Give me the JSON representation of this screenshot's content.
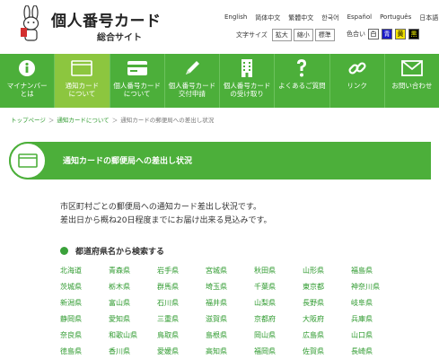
{
  "header": {
    "title": "個人番号カード",
    "subtitle": "総合サイト",
    "languages": [
      "English",
      "简体中文",
      "繁體中文",
      "한국어",
      "Español",
      "Português",
      "日本語"
    ],
    "text_size": {
      "label": "文字サイズ",
      "options": [
        "拡大",
        "縮小",
        "標準"
      ]
    },
    "color": {
      "label": "色合い",
      "options": [
        "白",
        "青",
        "黄",
        "黒"
      ]
    }
  },
  "nav": [
    {
      "line1": "マイナンバー",
      "line2": "とは",
      "icon": "info-icon"
    },
    {
      "line1": "通知カード",
      "line2": "について",
      "icon": "card-window-icon",
      "active": true
    },
    {
      "line1": "個人番号カード",
      "line2": "について",
      "icon": "card-icon"
    },
    {
      "line1": "個人番号カード",
      "line2": "交付申請",
      "icon": "pencil-icon"
    },
    {
      "line1": "個人番号カード",
      "line2": "の受け取り",
      "icon": "building-icon"
    },
    {
      "line1": "よくあるご質問",
      "line2": "",
      "icon": "question-icon"
    },
    {
      "line1": "リンク",
      "line2": "",
      "icon": "link-icon"
    },
    {
      "line1": "お問い合わせ",
      "line2": "",
      "icon": "mail-icon"
    }
  ],
  "breadcrumb": [
    "トップページ",
    "＞",
    "通知カードについて",
    "＞",
    "通知カードの郵便局への差出し状況"
  ],
  "page_title": "通知カードの郵便局への差出し状況",
  "description": {
    "line1": "市区町村ごとの郵便局への通知カード差出し状況です。",
    "line2": "差出日から概ね20日程度までにお届け出来る見込みです。"
  },
  "section_heading": "都道府県名から検索する",
  "prefectures": [
    "北海道",
    "青森県",
    "岩手県",
    "宮城県",
    "秋田県",
    "山形県",
    "福島県",
    "茨城県",
    "栃木県",
    "群馬県",
    "埼玉県",
    "千葉県",
    "東京都",
    "神奈川県",
    "新潟県",
    "富山県",
    "石川県",
    "福井県",
    "山梨県",
    "長野県",
    "岐阜県",
    "静岡県",
    "愛知県",
    "三重県",
    "滋賀県",
    "京都府",
    "大阪府",
    "兵庫県",
    "奈良県",
    "和歌山県",
    "鳥取県",
    "島根県",
    "岡山県",
    "広島県",
    "山口県",
    "徳島県",
    "香川県",
    "愛媛県",
    "高知県",
    "福岡県",
    "佐賀県",
    "長崎県"
  ]
}
